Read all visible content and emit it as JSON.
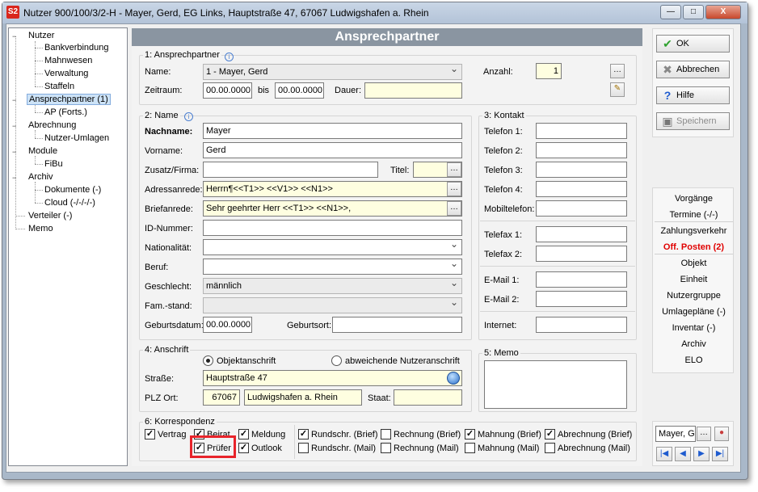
{
  "window": {
    "title": "Nutzer 900/100/3/2-H - Mayer, Gerd, EG Links, Hauptstraße 47, 67067 Ludwigshafen a. Rhein",
    "logo": "S2",
    "close_label": "X"
  },
  "tree": {
    "items": [
      {
        "label": "Nutzer",
        "level": 0,
        "toggle": "−"
      },
      {
        "label": "Bankverbindung",
        "level": 1
      },
      {
        "label": "Mahnwesen",
        "level": 1
      },
      {
        "label": "Verwaltung",
        "level": 1
      },
      {
        "label": "Staffeln",
        "level": 1
      },
      {
        "label": "Ansprechpartner (1)",
        "level": 0,
        "toggle": "−",
        "selected": true
      },
      {
        "label": "AP (Forts.)",
        "level": 1
      },
      {
        "label": "Abrechnung",
        "level": 0,
        "toggle": "−"
      },
      {
        "label": "Nutzer-Umlagen",
        "level": 1
      },
      {
        "label": "Module",
        "level": 0,
        "toggle": "−"
      },
      {
        "label": "FiBu",
        "level": 1
      },
      {
        "label": "Archiv",
        "level": 0,
        "toggle": "−"
      },
      {
        "label": "Dokumente (-)",
        "level": 1
      },
      {
        "label": "Cloud (-/-/-/-)",
        "level": 1
      },
      {
        "label": "Verteiler (-)",
        "level": 0
      },
      {
        "label": "Memo",
        "level": 0
      }
    ]
  },
  "header": {
    "title": "Ansprechpartner"
  },
  "ansprechpartner": {
    "section": "1: Ansprechpartner",
    "name_label": "Name:",
    "name_value": "1 - Mayer, Gerd",
    "zeitraum_label": "Zeitraum:",
    "zeitraum_from": "00.00.0000",
    "bis_label": "bis",
    "zeitraum_to": "00.00.0000",
    "dauer_label": "Dauer:",
    "dauer_value": "",
    "anzahl_label": "Anzahl:",
    "anzahl_value": "1"
  },
  "name": {
    "section": "2: Name",
    "nachname_label": "Nachname:",
    "nachname": "Mayer",
    "vorname_label": "Vorname:",
    "vorname": "Gerd",
    "zusatz_label": "Zusatz/Firma:",
    "zusatz": "",
    "titel_label": "Titel:",
    "titel": "",
    "adressanrede_label": "Adressanrede:",
    "adressanrede": "Herrn¶<<T1>> <<V1>> <<N1>>",
    "briefanrede_label": "Briefanrede:",
    "briefanrede": "Sehr geehrter Herr <<T1>> <<N1>>,",
    "id_label": "ID-Nummer:",
    "id": "",
    "nationalitaet_label": "Nationalität:",
    "nationalitaet": "",
    "beruf_label": "Beruf:",
    "beruf": "",
    "geschlecht_label": "Geschlecht:",
    "geschlecht": "männlich",
    "famstand_label": "Fam.-stand:",
    "famstand": "",
    "geburtsdatum_label": "Geburtsdatum:",
    "geburtsdatum": "00.00.0000",
    "geburtsort_label": "Geburtsort:",
    "geburtsort": ""
  },
  "kontakt": {
    "section": "3: Kontakt",
    "telefon1_label": "Telefon 1:",
    "telefon2_label": "Telefon 2:",
    "telefon3_label": "Telefon 3:",
    "telefon4_label": "Telefon 4:",
    "mobil_label": "Mobiltelefon:",
    "fax1_label": "Telefax 1:",
    "fax2_label": "Telefax 2:",
    "email1_label": "E-Mail 1:",
    "email2_label": "E-Mail 2:",
    "internet_label": "Internet:"
  },
  "anschrift": {
    "section": "4: Anschrift",
    "radio_objekt": "Objektanschrift",
    "radio_abw": "abweichende Nutzeranschrift",
    "strasse_label": "Straße:",
    "strasse": "Hauptstraße 47",
    "plzort_label": "PLZ Ort:",
    "plz": "67067",
    "ort": "Ludwigshafen a. Rhein",
    "staat_label": "Staat:",
    "staat": ""
  },
  "memo": {
    "section": "5: Memo"
  },
  "korrespondenz": {
    "section": "6: Korrespondenz",
    "vertrag": "Vertrag",
    "beirat": "Beirat",
    "meldung": "Meldung",
    "pruefer": "Prüfer",
    "outlook": "Outlook",
    "rb": "Rundschr. (Brief)",
    "rm": "Rundschr. (Mail)",
    "reb": "Rechnung (Brief)",
    "rem": "Rechnung (Mail)",
    "mb": "Mahnung (Brief)",
    "mm": "Mahnung (Mail)",
    "ab": "Abrechnung (Brief)",
    "am": "Abrechnung (Mail)"
  },
  "buttons": {
    "ok": "OK",
    "abbrechen": "Abbrechen",
    "hilfe": "Hilfe",
    "speichern": "Speichern"
  },
  "nav": {
    "items": [
      "Vorgänge",
      "Termine (-/-)",
      "Zahlungsverkehr",
      "Off. Posten (2)",
      "Objekt",
      "Einheit",
      "Nutzergruppe",
      "Umlagepläne (-)",
      "Inventar (-)",
      "Archiv",
      "ELO"
    ]
  },
  "bottom": {
    "record_value": "Mayer, G"
  },
  "colors": {
    "header": "#8a95a1",
    "highlight": "#e8242a",
    "offene_posten": "#e00000"
  }
}
